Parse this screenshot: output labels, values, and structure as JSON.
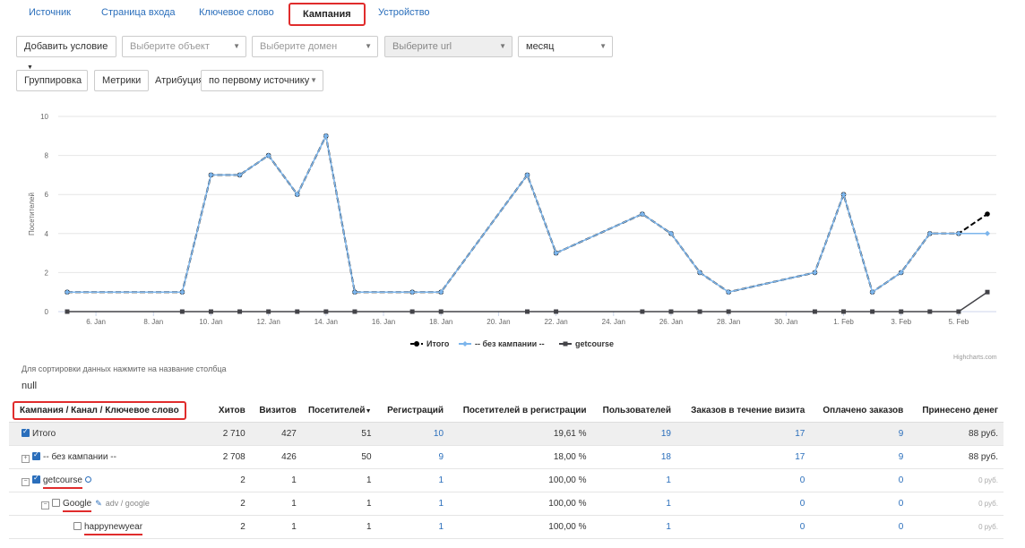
{
  "tabs": [
    "Источник",
    "Страница входа",
    "Ключевое слово",
    "Кампания",
    "Устройство"
  ],
  "active_tab": "Кампания",
  "filters": {
    "add_condition": "Добавить условие",
    "object_placeholder": "Выберите объект",
    "domain_placeholder": "Выберите домен",
    "url_placeholder": "Выберите url",
    "period": "месяц"
  },
  "controls": {
    "grouping": "Группировка",
    "metrics": "Метрики",
    "attribution_label": "Атрибуция",
    "attribution_value": "по первому источнику"
  },
  "chart_data": {
    "type": "line",
    "ylabel": "Посетителей",
    "ylim": [
      0,
      10
    ],
    "yticks": [
      0,
      2,
      4,
      6,
      8,
      10
    ],
    "xticks": [
      "6. Jan",
      "8. Jan",
      "10. Jan",
      "12. Jan",
      "14. Jan",
      "16. Jan",
      "18. Jan",
      "20. Jan",
      "22. Jan",
      "24. Jan",
      "26. Jan",
      "28. Jan",
      "30. Jan",
      "1. Feb",
      "3. Feb",
      "5. Feb"
    ],
    "x_day_range": [
      4,
      35
    ],
    "series": [
      {
        "name": "Итого",
        "color": "#000000",
        "dashed": true,
        "points": [
          [
            5,
            1
          ],
          [
            9,
            1
          ],
          [
            10,
            7
          ],
          [
            11,
            7
          ],
          [
            12,
            8
          ],
          [
            13,
            6
          ],
          [
            14,
            9
          ],
          [
            15,
            1
          ],
          [
            17,
            1
          ],
          [
            18,
            1
          ],
          [
            21,
            7
          ],
          [
            22,
            3
          ],
          [
            25,
            5
          ],
          [
            26,
            4
          ],
          [
            27,
            2
          ],
          [
            28,
            1
          ],
          [
            31,
            2
          ],
          [
            32,
            6
          ],
          [
            33,
            1
          ],
          [
            34,
            2
          ],
          [
            35,
            4
          ],
          [
            36,
            4
          ],
          [
            37,
            5
          ]
        ]
      },
      {
        "name": "-- без кампании --",
        "color": "#7cb5ec",
        "dashed": false,
        "points": [
          [
            5,
            1
          ],
          [
            9,
            1
          ],
          [
            10,
            7
          ],
          [
            11,
            7
          ],
          [
            12,
            8
          ],
          [
            13,
            6
          ],
          [
            14,
            9
          ],
          [
            15,
            1
          ],
          [
            17,
            1
          ],
          [
            18,
            1
          ],
          [
            21,
            7
          ],
          [
            22,
            3
          ],
          [
            25,
            5
          ],
          [
            26,
            4
          ],
          [
            27,
            2
          ],
          [
            28,
            1
          ],
          [
            31,
            2
          ],
          [
            32,
            6
          ],
          [
            33,
            1
          ],
          [
            34,
            2
          ],
          [
            35,
            4
          ],
          [
            36,
            4
          ],
          [
            37,
            4
          ]
        ]
      },
      {
        "name": "getcourse",
        "color": "#434348",
        "dashed": false,
        "points": [
          [
            5,
            0
          ],
          [
            9,
            0
          ],
          [
            10,
            0
          ],
          [
            11,
            0
          ],
          [
            12,
            0
          ],
          [
            13,
            0
          ],
          [
            14,
            0
          ],
          [
            15,
            0
          ],
          [
            17,
            0
          ],
          [
            18,
            0
          ],
          [
            21,
            0
          ],
          [
            22,
            0
          ],
          [
            25,
            0
          ],
          [
            26,
            0
          ],
          [
            27,
            0
          ],
          [
            28,
            0
          ],
          [
            31,
            0
          ],
          [
            32,
            0
          ],
          [
            33,
            0
          ],
          [
            34,
            0
          ],
          [
            35,
            0
          ],
          [
            36,
            0
          ],
          [
            37,
            1
          ]
        ]
      }
    ]
  },
  "credits": "Highcharts.com",
  "hint": "Для сортировки данных нажмите на название столбца",
  "null_text": "null",
  "table": {
    "columns": [
      "Кампания / Канал / Ключевое слово",
      "Хитов",
      "Визитов",
      "Посетителей",
      "Регистраций",
      "Посетителей в регистрации",
      "Пользователей",
      "Заказов в течение визита",
      "Оплачено заказов",
      "Принесено денег"
    ],
    "rows": [
      {
        "name": "Итого",
        "cells": [
          "2 710",
          "427",
          "51",
          "10",
          "19,61 %",
          "19",
          "17",
          "9",
          "88 руб."
        ]
      },
      {
        "name": "-- без кампании --",
        "cells": [
          "2 708",
          "426",
          "50",
          "9",
          "18,00 %",
          "18",
          "17",
          "9",
          "88 руб."
        ]
      },
      {
        "name": "getcourse",
        "cells": [
          "2",
          "1",
          "1",
          "1",
          "100,00 %",
          "1",
          "0",
          "0",
          "0 руб."
        ]
      },
      {
        "name": "Google",
        "sub": "adv / google",
        "cells": [
          "2",
          "1",
          "1",
          "1",
          "100,00 %",
          "1",
          "0",
          "0",
          "0 руб."
        ]
      },
      {
        "name": "happynewyear",
        "cells": [
          "2",
          "1",
          "1",
          "1",
          "100,00 %",
          "1",
          "0",
          "0",
          "0 руб."
        ]
      }
    ]
  }
}
